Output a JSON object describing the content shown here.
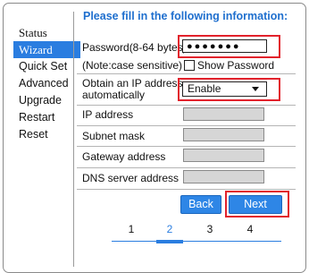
{
  "sidebar": {
    "items": [
      {
        "label": "Status"
      },
      {
        "label": "Wizard"
      },
      {
        "label": "Quick Set"
      },
      {
        "label": "Advanced"
      },
      {
        "label": "Upgrade"
      },
      {
        "label": "Restart"
      },
      {
        "label": "Reset"
      }
    ],
    "active_index": 1
  },
  "form": {
    "heading": "Please fill in the following information:",
    "password": {
      "label": "Password(8-64 bytes)",
      "note": "(Note:case sensitive)",
      "masked_value": "●●●●●●●",
      "show_password_label": "Show Password",
      "show_password_checked": false
    },
    "dhcp": {
      "label_line1": "Obtain an IP address",
      "label_line2": "automatically",
      "selected": "Enable"
    },
    "ip_address": {
      "label": "IP address"
    },
    "subnet_mask": {
      "label": "Subnet mask"
    },
    "gateway": {
      "label": "Gateway address"
    },
    "dns": {
      "label": "DNS server address"
    }
  },
  "buttons": {
    "back": "Back",
    "next": "Next"
  },
  "pager": {
    "pages": [
      "1",
      "2",
      "3",
      "4"
    ],
    "current": "2"
  },
  "colors": {
    "accent": "#2a7de0",
    "heading": "#1f6fce",
    "highlight": "#e2222c",
    "disabled_input": "#d6d6d6"
  }
}
